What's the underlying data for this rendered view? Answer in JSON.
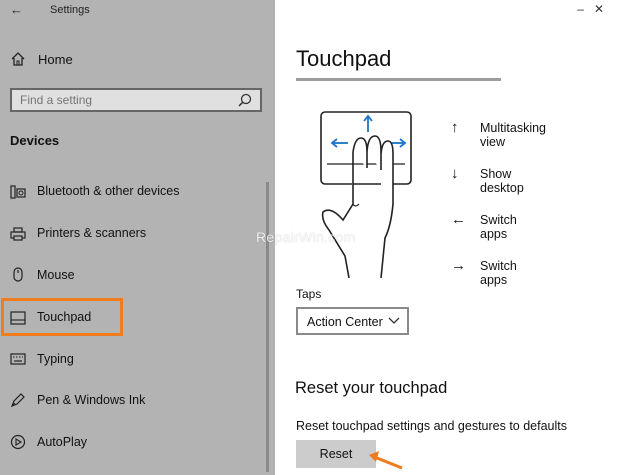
{
  "app": {
    "title": "Settings"
  },
  "sidebar": {
    "home_label": "Home",
    "search_placeholder": "Find a setting",
    "section_title": "Devices",
    "items": [
      {
        "label": "Bluetooth & other devices",
        "icon": "bluetooth-devices-icon"
      },
      {
        "label": "Printers & scanners",
        "icon": "printer-icon"
      },
      {
        "label": "Mouse",
        "icon": "mouse-icon"
      },
      {
        "label": "Touchpad",
        "icon": "touchpad-icon",
        "selected": true
      },
      {
        "label": "Typing",
        "icon": "keyboard-icon"
      },
      {
        "label": "Pen & Windows Ink",
        "icon": "pen-icon"
      },
      {
        "label": "AutoPlay",
        "icon": "autoplay-icon"
      }
    ]
  },
  "main": {
    "title": "Touchpad",
    "gestures": [
      {
        "arrow": "↑",
        "label": "Multitasking view"
      },
      {
        "arrow": "↓",
        "label": "Show desktop"
      },
      {
        "arrow": "←",
        "label": "Switch apps"
      },
      {
        "arrow": "→",
        "label": "Switch apps"
      }
    ],
    "taps": {
      "label": "Taps",
      "value": "Action Center"
    },
    "reset": {
      "heading": "Reset your touchpad",
      "description": "Reset touchpad settings and gestures to defaults",
      "button_label": "Reset"
    }
  },
  "watermark": "RepairWin.com",
  "colors": {
    "highlight": "#f07c1e",
    "sidebar_bg": "#b3b3b3",
    "gesture_arrows": "#1a73c7"
  }
}
